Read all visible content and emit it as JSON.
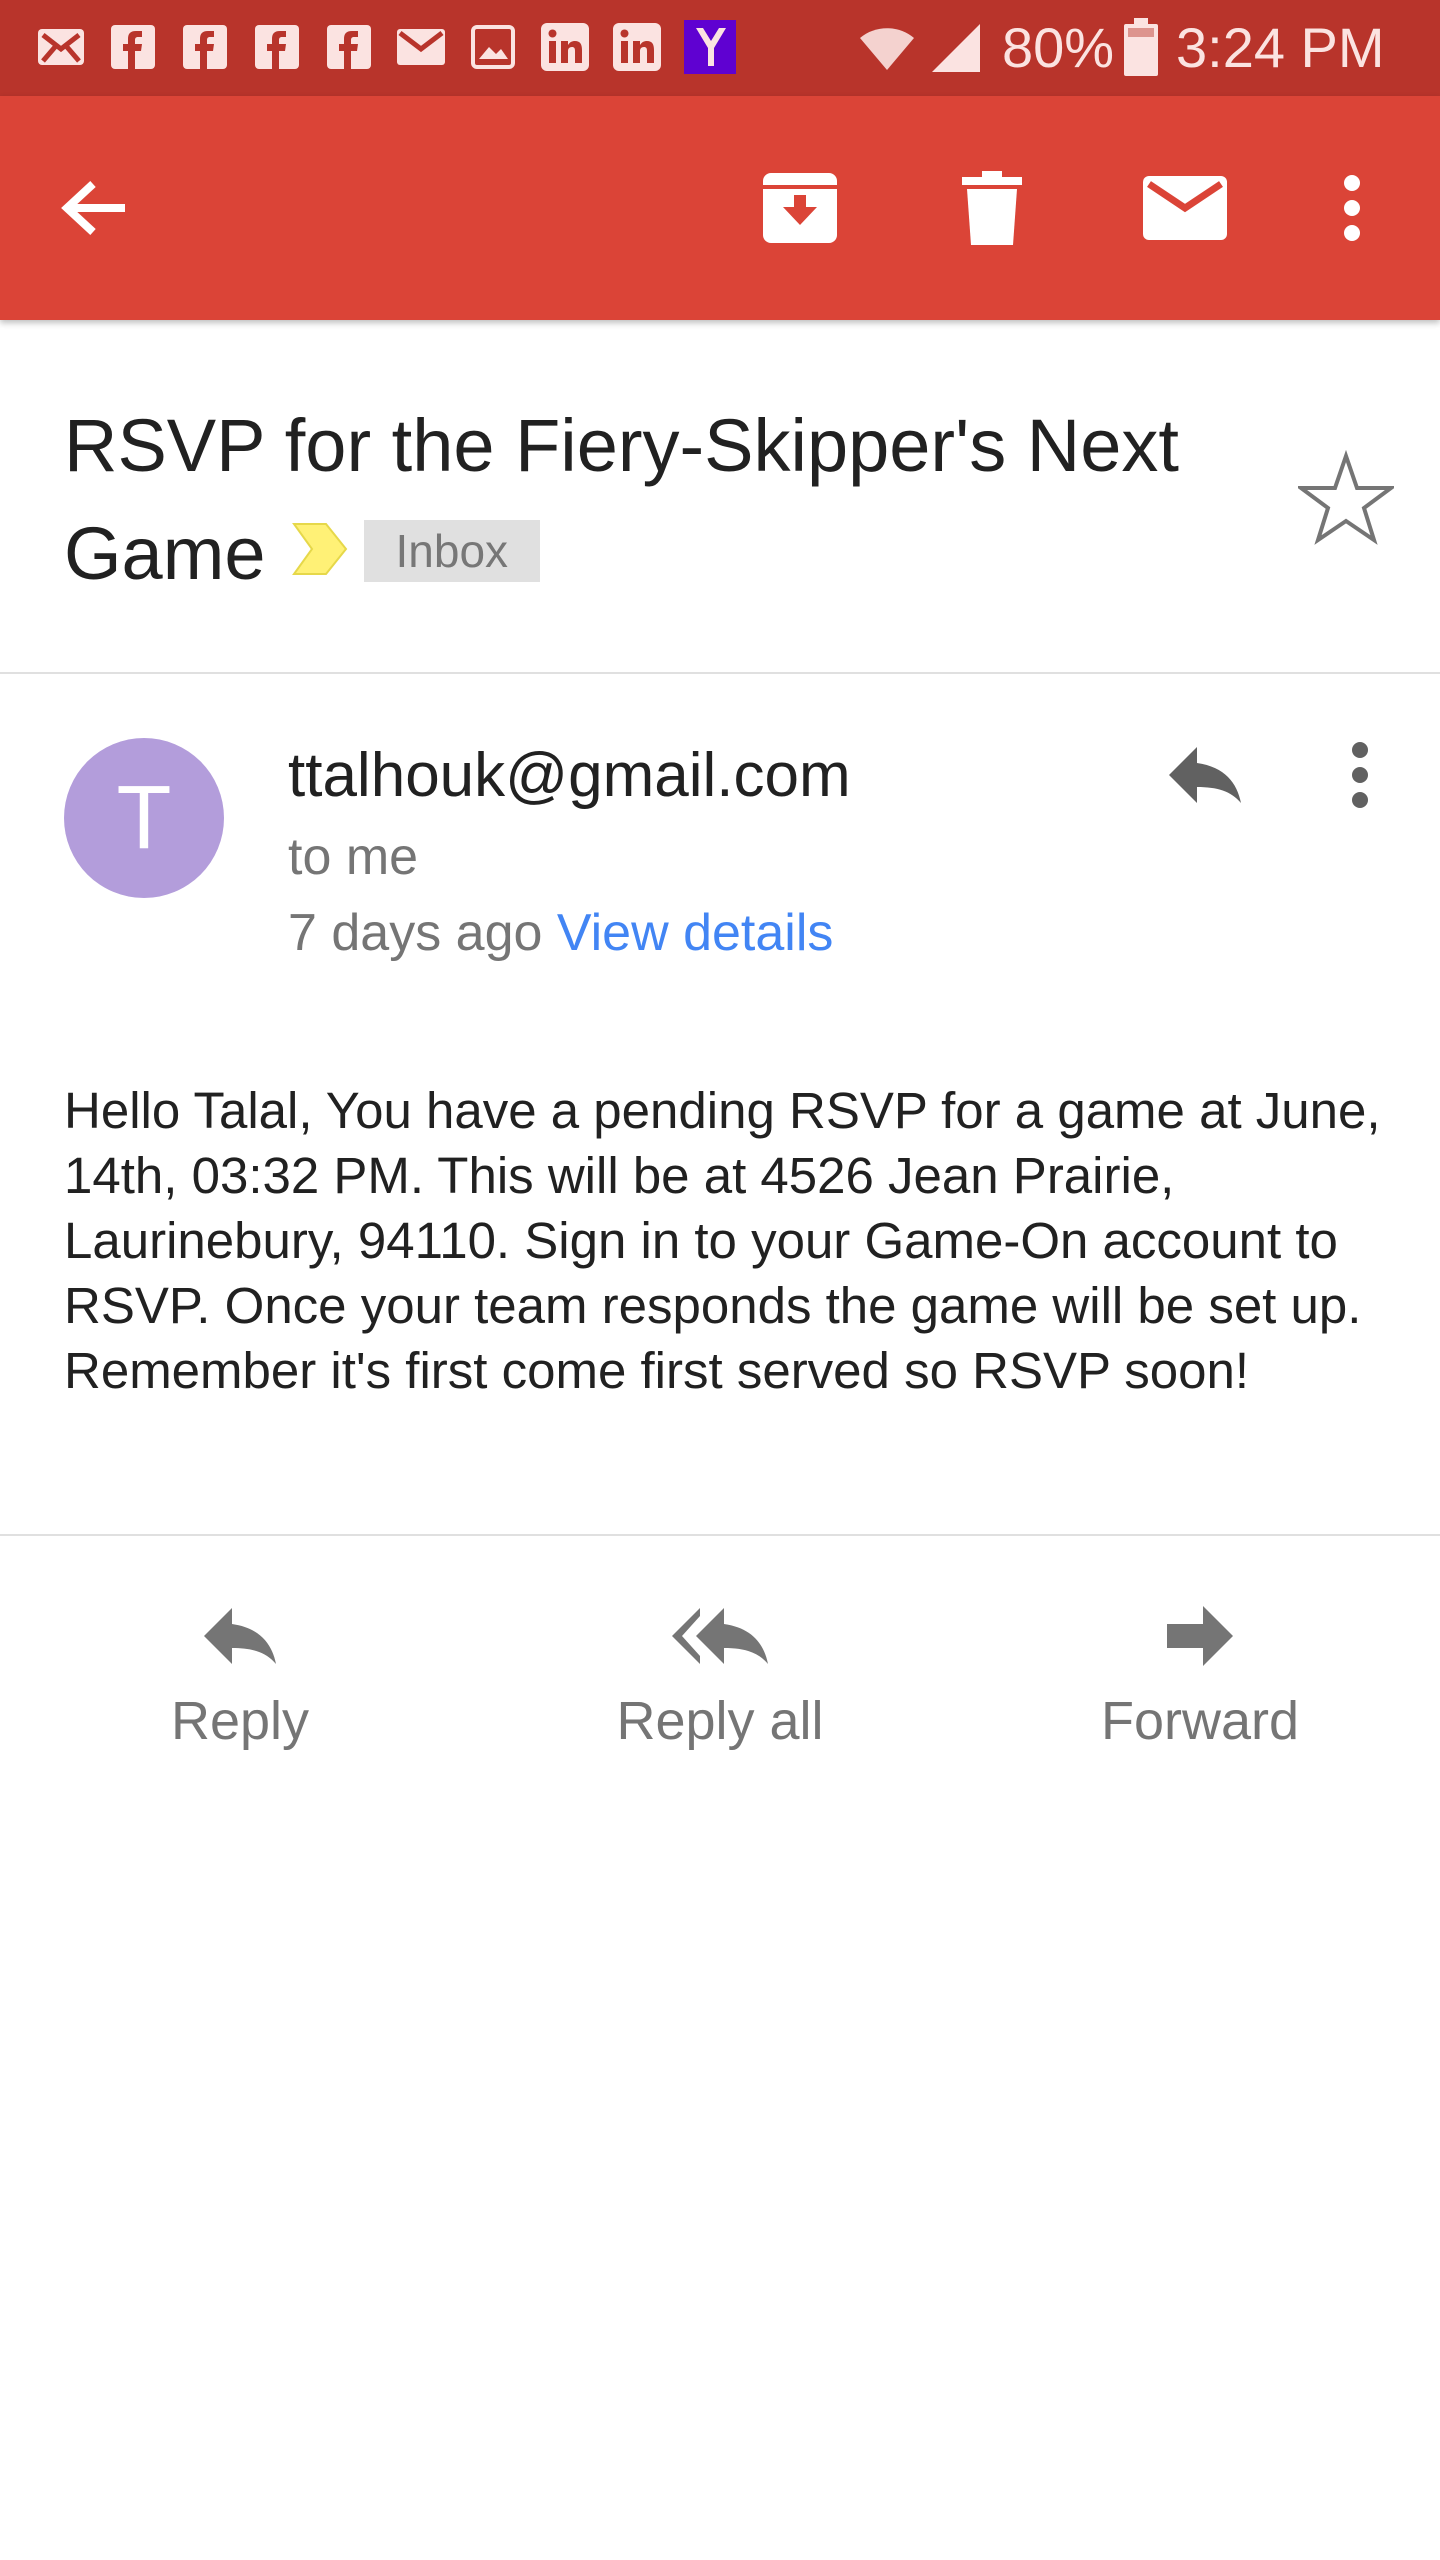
{
  "status_bar": {
    "notification_icons": [
      "email-icon",
      "facebook-icon",
      "facebook-icon",
      "facebook-icon",
      "facebook-icon",
      "gmail-icon",
      "photo-icon",
      "linkedin-icon",
      "linkedin-icon",
      "yahoo-icon"
    ],
    "battery": "80%",
    "time": "3:24 PM"
  },
  "toolbar": {
    "back_icon": "arrow-back-icon",
    "archive_icon": "archive-icon",
    "delete_icon": "trash-icon",
    "mark_unread_icon": "mail-icon",
    "overflow_icon": "more-vert-icon"
  },
  "email": {
    "subject": "RSVP for the Fiery-Skipper's Next Game",
    "label": "Inbox",
    "sender_initial": "T",
    "sender": "ttalhouk@gmail.com",
    "recipient": "to me",
    "time_ago": "7 days ago",
    "view_details": "View details",
    "body": "Hello Talal, You have a pending RSVP for a game at June, 14th, 03:32 PM. This will be at 4526 Jean Prairie, Laurinebury, 94110. Sign in to your Game-On account to RSVP. Once your team responds the game will be set up. Remember it's first come first served so RSVP soon!"
  },
  "actions": {
    "reply": "Reply",
    "reply_all": "Reply all",
    "forward": "Forward"
  },
  "colors": {
    "app_bar": "#db4437",
    "status_bar": "#b8342b",
    "avatar": "#b39ddb",
    "link": "#4285f4",
    "important_marker": "#fff176"
  }
}
